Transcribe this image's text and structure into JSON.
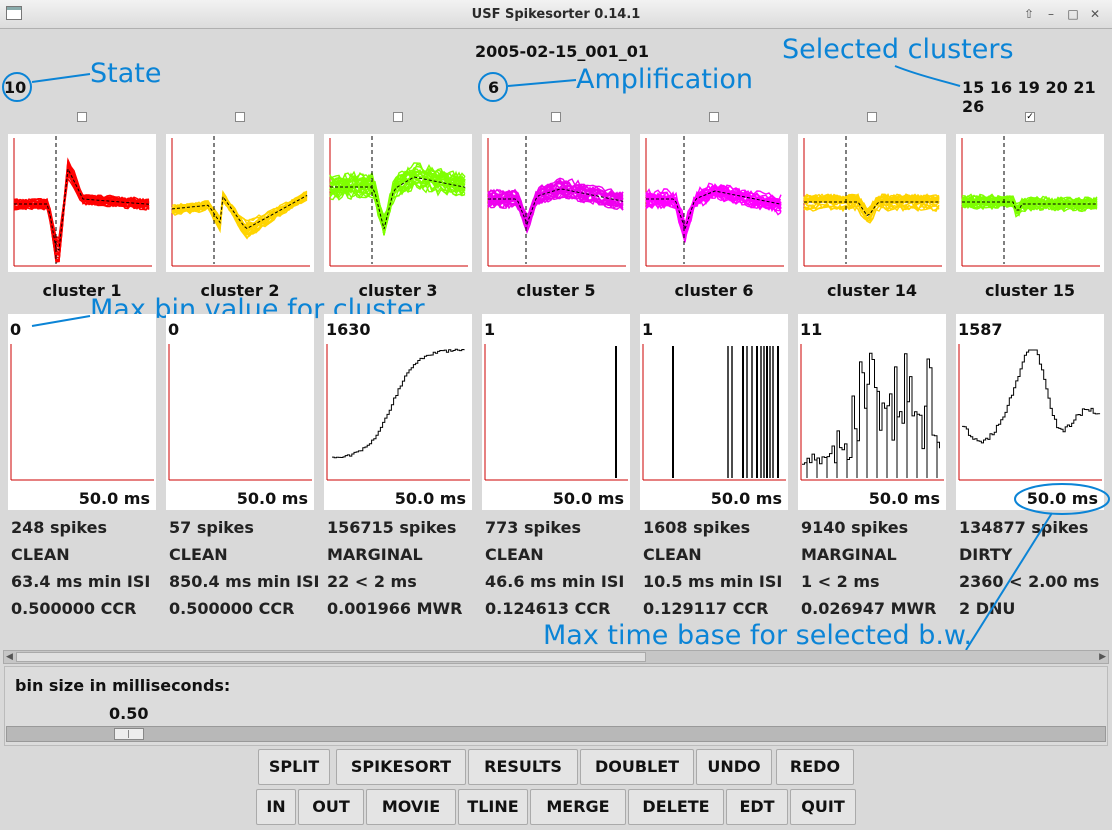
{
  "window": {
    "title": "USF Spikesorter 0.14.1"
  },
  "header": {
    "filename": "2005-02-15_001_01",
    "state_value": "10",
    "amplification_value": "6",
    "selected_clusters": "15 16 19 20 21 26"
  },
  "annotations": {
    "state": "State",
    "amplification": "Amplification",
    "selected_clusters": "Selected clusters",
    "max_bin": "Max bin value for cluster",
    "max_time": "Max time base for selected b.w."
  },
  "clusters": [
    {
      "label": "cluster 1",
      "checked": false,
      "color": "#ff0000",
      "max_bin": "0",
      "time_base": "50.0 ms",
      "spikes": "248 spikes",
      "quality": "CLEAN",
      "isi": "63.4 ms min ISI",
      "metric": "0.500000 CCR"
    },
    {
      "label": "cluster 2",
      "checked": false,
      "color": "#ffd400",
      "max_bin": "0",
      "time_base": "50.0 ms",
      "spikes": "57 spikes",
      "quality": "CLEAN",
      "isi": "850.4 ms min ISI",
      "metric": "0.500000 CCR"
    },
    {
      "label": "cluster 3",
      "checked": false,
      "color": "#7fff00",
      "max_bin": "1630",
      "time_base": "50.0 ms",
      "spikes": "156715 spikes",
      "quality": "MARGINAL",
      "isi": "22 < 2 ms",
      "metric": "0.001966 MWR"
    },
    {
      "label": "cluster 5",
      "checked": false,
      "color": "#ee00ee",
      "max_bin": "1",
      "time_base": "50.0 ms",
      "spikes": "773 spikes",
      "quality": "CLEAN",
      "isi": "46.6 ms min ISI",
      "metric": "0.124613 CCR"
    },
    {
      "label": "cluster 6",
      "checked": false,
      "color": "#ff00ff",
      "max_bin": "1",
      "time_base": "50.0 ms",
      "spikes": "1608 spikes",
      "quality": "CLEAN",
      "isi": "10.5 ms min ISI",
      "metric": "0.129117 CCR"
    },
    {
      "label": "cluster 14",
      "checked": false,
      "color": "#ffd400",
      "max_bin": "11",
      "time_base": "50.0 ms",
      "spikes": "9140 spikes",
      "quality": "MARGINAL",
      "isi": "1 < 2 ms",
      "metric": "0.026947 MWR"
    },
    {
      "label": "cluster 15",
      "checked": true,
      "color": "#7fff00",
      "max_bin": "1587",
      "time_base": "50.0 ms",
      "spikes": "134877 spikes",
      "quality": "DIRTY",
      "isi": "2360 < 2.00 ms",
      "metric": "2 DNU"
    }
  ],
  "binsize": {
    "label": "bin size in milliseconds:",
    "value": "0.50",
    "fraction": 0.04
  },
  "buttons_row1": [
    "SPLIT",
    "SPIKESORT",
    "RESULTS",
    "DOUBLET",
    "UNDO",
    "REDO"
  ],
  "buttons_row2": [
    "IN",
    "OUT",
    "MOVIE",
    "TLINE",
    "MERGE",
    "DELETE",
    "EDT",
    "QUIT"
  ]
}
